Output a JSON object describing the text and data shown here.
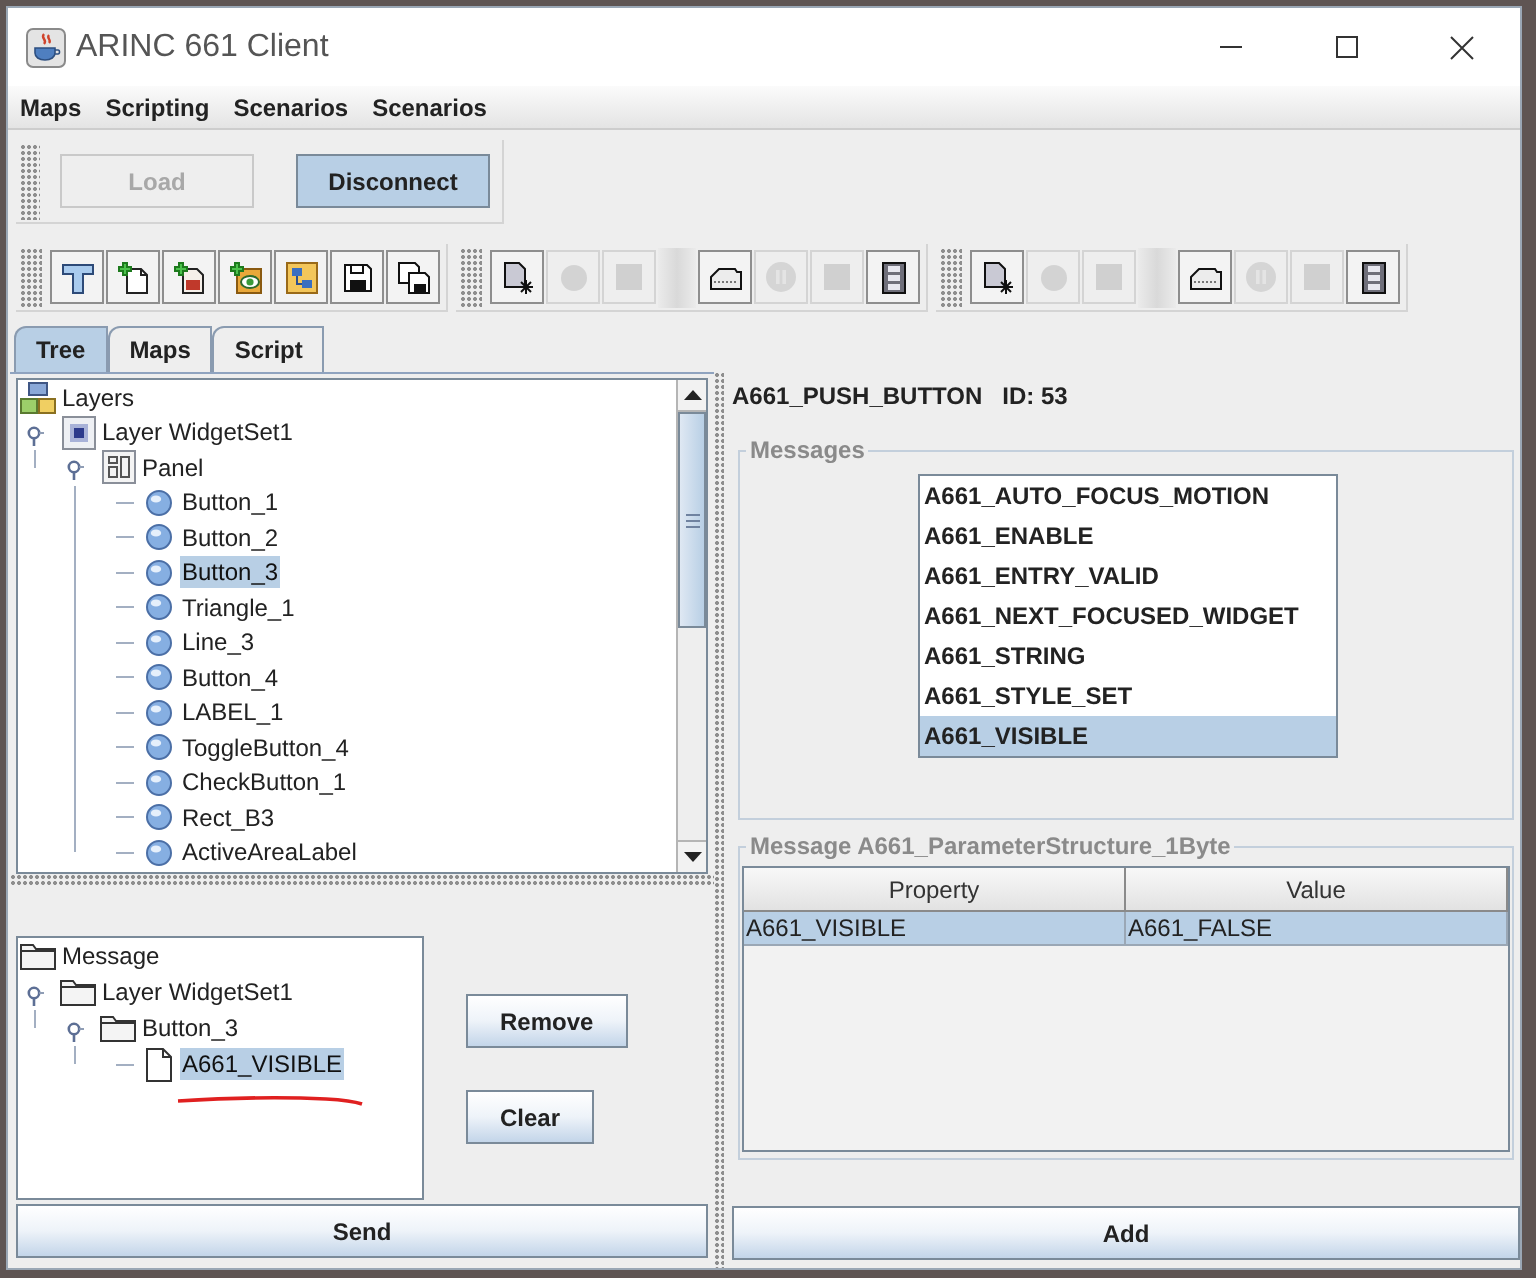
{
  "window": {
    "title": "ARINC 661 Client"
  },
  "menu": [
    {
      "label": "Maps"
    },
    {
      "label": "Scripting"
    },
    {
      "label": "Scenarios"
    },
    {
      "label": "Scenarios"
    }
  ],
  "connection": [
    {
      "label": "Load",
      "disabled": true,
      "active": false
    },
    {
      "label": "Disconnect",
      "disabled": false,
      "active": true
    }
  ],
  "toolbars": [
    {
      "buttons": [
        {
          "kind": "hammer",
          "disabled": false
        },
        {
          "kind": "docplus",
          "disabled": false
        },
        {
          "kind": "scriptplus",
          "disabled": false
        },
        {
          "kind": "eyeplus",
          "disabled": false
        },
        {
          "kind": "diagram",
          "disabled": false
        },
        {
          "kind": "save",
          "disabled": false
        },
        {
          "kind": "saveall",
          "disabled": false
        }
      ]
    },
    {
      "buttons": [
        {
          "kind": "sparkle",
          "disabled": false
        },
        {
          "kind": "record",
          "disabled": true
        },
        {
          "kind": "stop",
          "disabled": true
        },
        {
          "kind": "separator"
        },
        {
          "kind": "tray",
          "disabled": false
        },
        {
          "kind": "pause",
          "disabled": true
        },
        {
          "kind": "stop",
          "disabled": true
        },
        {
          "kind": "film",
          "disabled": false
        }
      ]
    },
    {
      "buttons": [
        {
          "kind": "sparkle",
          "disabled": false
        },
        {
          "kind": "record",
          "disabled": true
        },
        {
          "kind": "stop",
          "disabled": true
        },
        {
          "kind": "separator"
        },
        {
          "kind": "tray",
          "disabled": false
        },
        {
          "kind": "pause",
          "disabled": true
        },
        {
          "kind": "stop",
          "disabled": true
        },
        {
          "kind": "film",
          "disabled": false
        }
      ]
    }
  ],
  "tabs": [
    {
      "label": "Tree",
      "selected": true
    },
    {
      "label": "Maps",
      "selected": false
    },
    {
      "label": "Script",
      "selected": false
    }
  ],
  "layer_tree": [
    {
      "label": "Layers",
      "kind": "layers",
      "selected": false,
      "children": [
        {
          "label": "Layer WidgetSet1",
          "kind": "layer",
          "selected": false,
          "expanded": true,
          "children": [
            {
              "label": "Panel",
              "kind": "panel",
              "selected": false,
              "expanded": true,
              "children": [
                {
                  "label": "Button_1",
                  "kind": "widget",
                  "selected": false
                },
                {
                  "label": "Button_2",
                  "kind": "widget",
                  "selected": false
                },
                {
                  "label": "Button_3",
                  "kind": "widget",
                  "selected": true
                },
                {
                  "label": "Triangle_1",
                  "kind": "widget",
                  "selected": false
                },
                {
                  "label": "Line_3",
                  "kind": "widget",
                  "selected": false
                },
                {
                  "label": "Button_4",
                  "kind": "widget",
                  "selected": false
                },
                {
                  "label": "LABEL_1",
                  "kind": "widget",
                  "selected": false
                },
                {
                  "label": "ToggleButton_4",
                  "kind": "widget",
                  "selected": false
                },
                {
                  "label": "CheckButton_1",
                  "kind": "widget",
                  "selected": false
                },
                {
                  "label": "Rect_B3",
                  "kind": "widget",
                  "selected": false
                },
                {
                  "label": "ActiveAreaLabel",
                  "kind": "widget",
                  "selected": false
                }
              ]
            }
          ]
        }
      ]
    }
  ],
  "message_tree": [
    {
      "label": "Message",
      "kind": "folder",
      "selected": false,
      "children": [
        {
          "label": "Layer WidgetSet1",
          "kind": "folder",
          "selected": false,
          "expanded": true,
          "children": [
            {
              "label": "Button_3",
              "kind": "folder",
              "selected": false,
              "expanded": true,
              "children": [
                {
                  "label": "A661_VISIBLE",
                  "kind": "document",
                  "selected": true
                }
              ]
            }
          ]
        }
      ]
    }
  ],
  "message_actions": [
    {
      "label": "Remove"
    },
    {
      "label": "Clear"
    }
  ],
  "send_button": {
    "label": "Send"
  },
  "widget": {
    "type": "A661_PUSH_BUTTON",
    "id": "ID: 53"
  },
  "messages": {
    "title": "Messages",
    "items": [
      {
        "label": "A661_AUTO_FOCUS_MOTION",
        "selected": false
      },
      {
        "label": "A661_ENABLE",
        "selected": false
      },
      {
        "label": "A661_ENTRY_VALID",
        "selected": false
      },
      {
        "label": "A661_NEXT_FOCUSED_WIDGET",
        "selected": false
      },
      {
        "label": "A661_STRING",
        "selected": false
      },
      {
        "label": "A661_STYLE_SET",
        "selected": false
      },
      {
        "label": "A661_VISIBLE",
        "selected": true
      }
    ]
  },
  "parameters": {
    "title": "Message A661_ParameterStructure_1Byte",
    "columns": [
      "Property",
      "Value"
    ],
    "rows": [
      {
        "cells": [
          "A661_VISIBLE",
          "A661_FALSE"
        ],
        "selected": true
      }
    ]
  },
  "add_button": {
    "label": "Add"
  }
}
